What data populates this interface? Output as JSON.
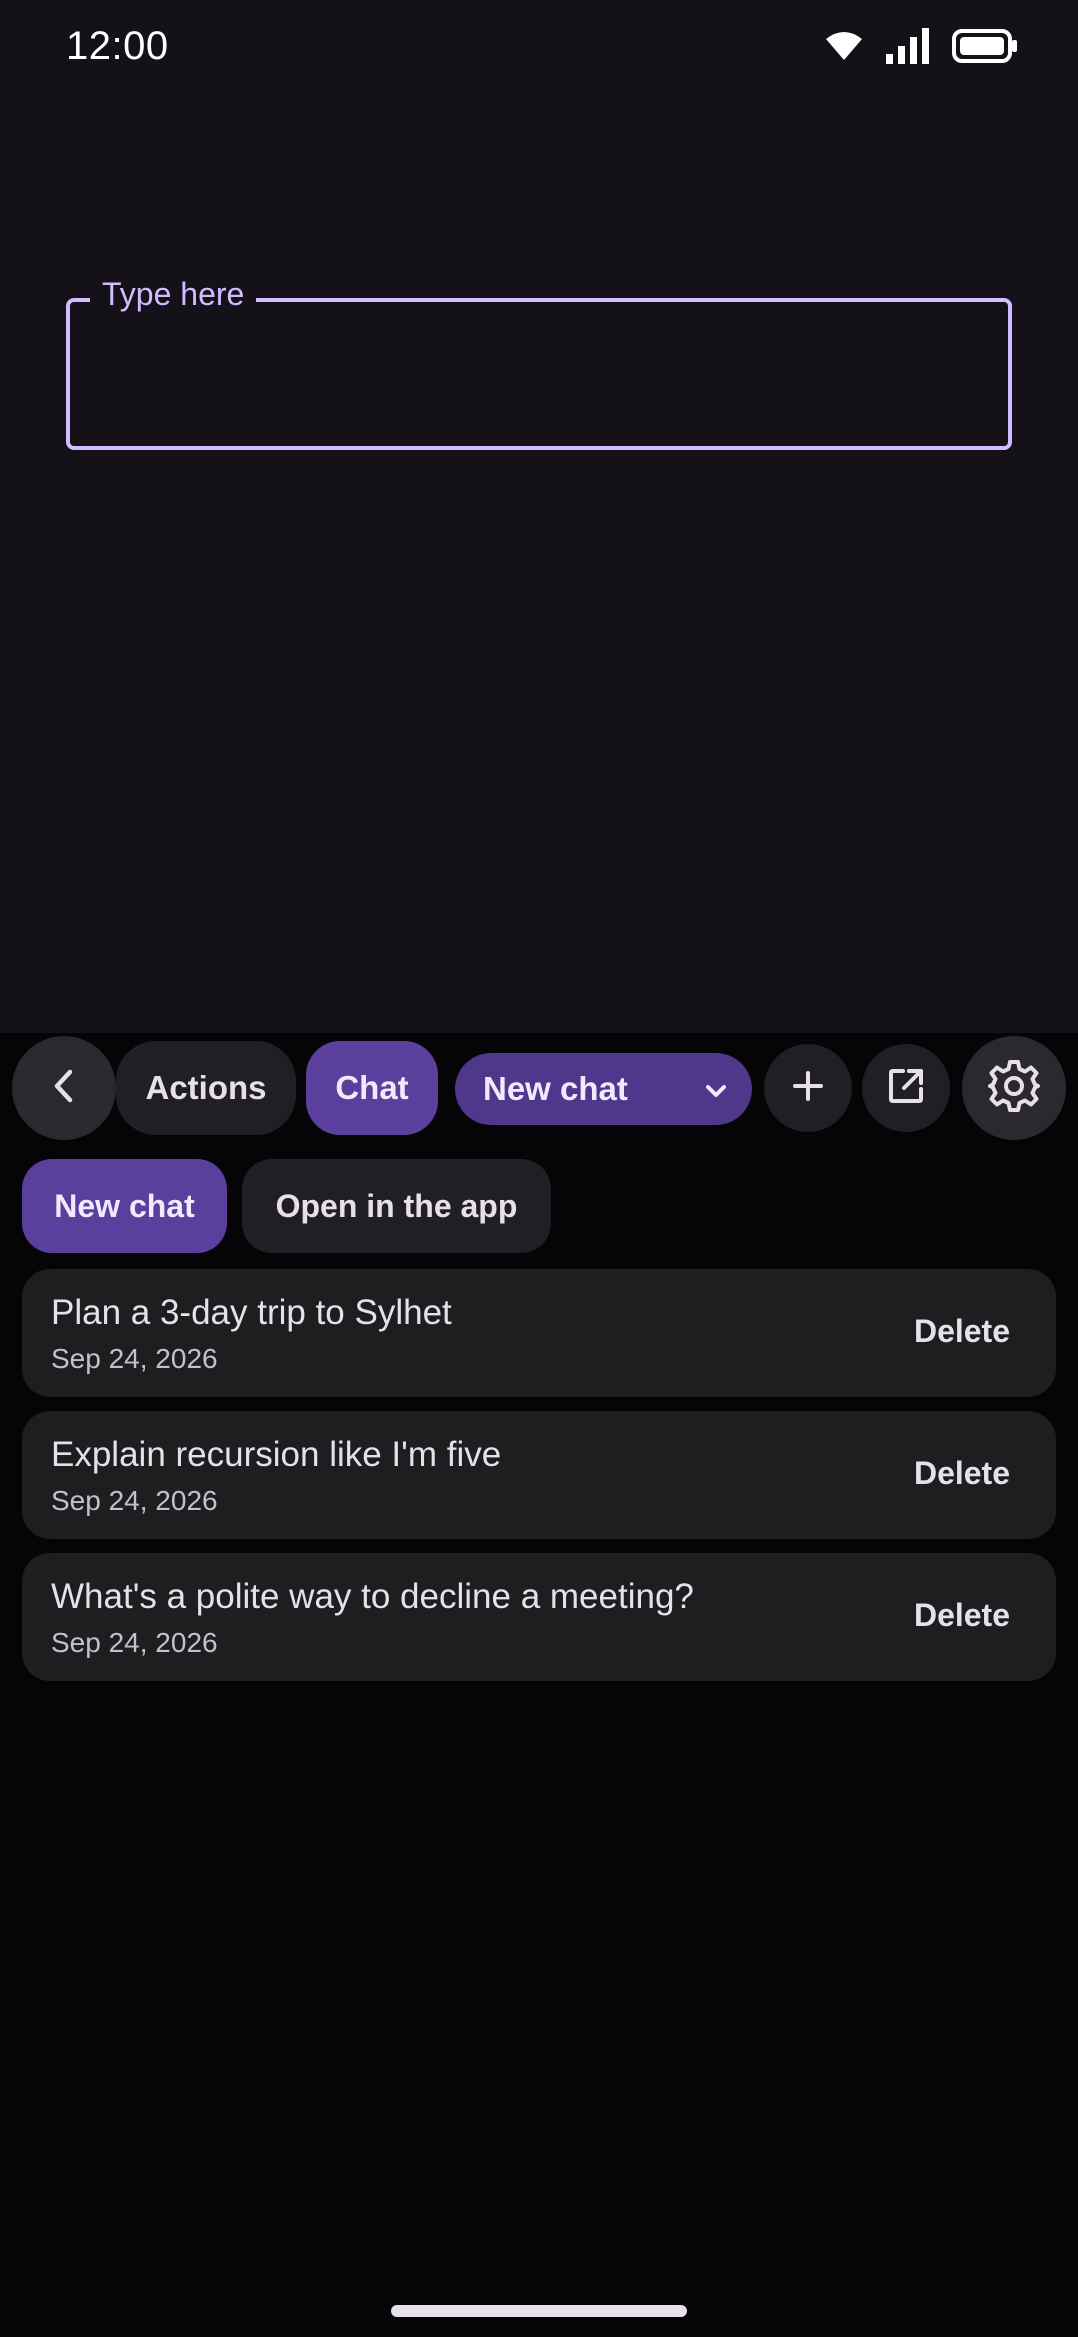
{
  "status_bar": {
    "time": "12:00"
  },
  "input": {
    "label": "Type here",
    "value": ""
  },
  "toolbar": {
    "actions_label": "Actions",
    "chat_label": "Chat",
    "chat_select_value": "New chat"
  },
  "chips": {
    "new_chat": "New chat",
    "open_in_app": "Open in the app"
  },
  "chats": [
    {
      "title": "Plan a 3-day trip to Sylhet",
      "date": "Sep 24, 2026",
      "action": "Delete"
    },
    {
      "title": "Explain recursion like I'm five",
      "date": "Sep 24, 2026",
      "action": "Delete"
    },
    {
      "title": "What's a polite way to decline a meeting?",
      "date": "Sep 24, 2026",
      "action": "Delete"
    }
  ],
  "colors": {
    "background": "#141218",
    "panel": "#050407",
    "accent": "#d0bcff",
    "primary_container": "#5b3f9c",
    "card": "#1e1d20"
  },
  "icons": [
    "wifi-icon",
    "signal-icon",
    "battery-icon",
    "chevron-left-icon",
    "chevron-down-icon",
    "plus-icon",
    "open-external-icon",
    "gear-icon"
  ]
}
